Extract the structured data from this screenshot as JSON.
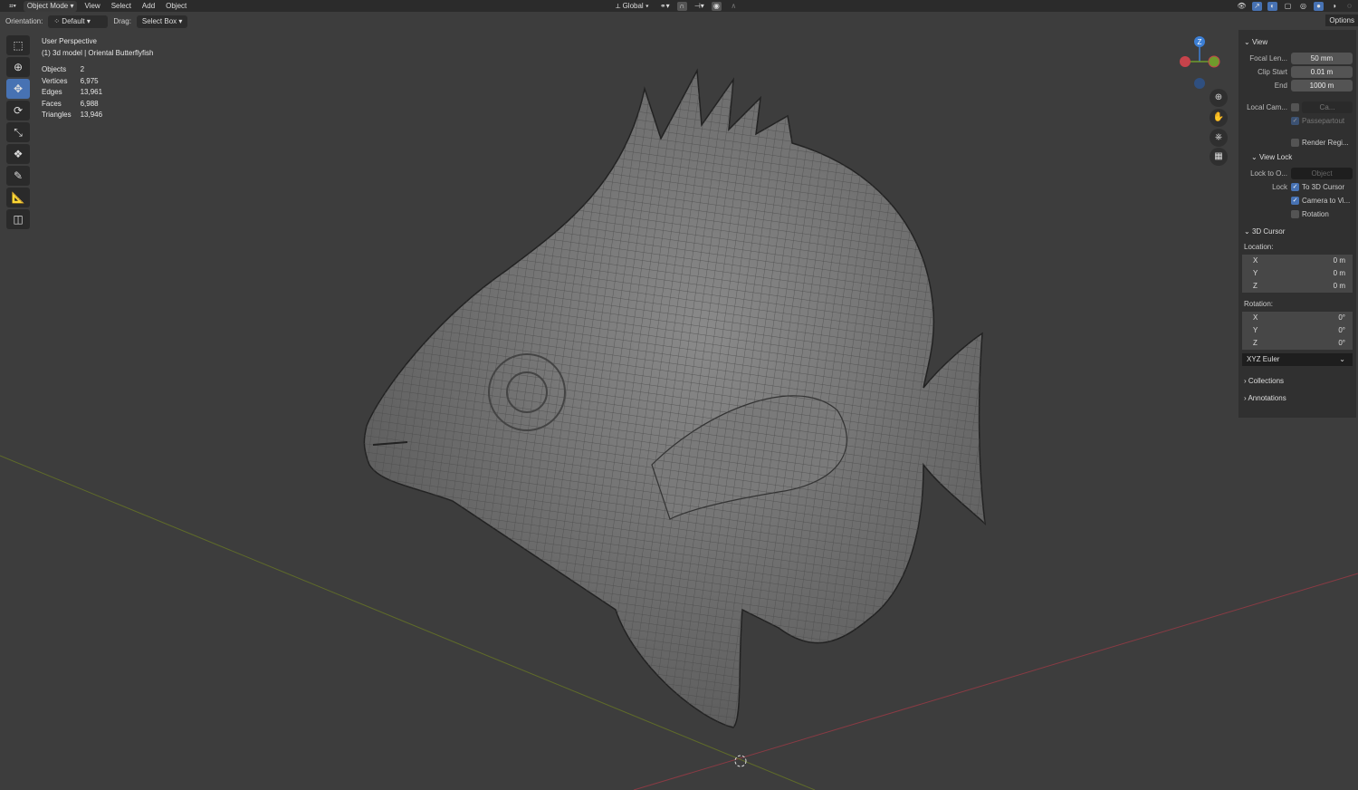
{
  "topbar": {
    "mode": "Object Mode",
    "menus": [
      "View",
      "Select",
      "Add",
      "Object"
    ],
    "transform_orientation": "Global"
  },
  "toolheader": {
    "orientation_label": "Orientation:",
    "orientation_value": "Default",
    "drag_label": "Drag:",
    "drag_value": "Select Box",
    "options": "Options"
  },
  "overlay": {
    "view": "User Perspective",
    "object": "(1) 3d model | Oriental Butterflyfish",
    "stats": [
      {
        "k": "Objects",
        "v": "2"
      },
      {
        "k": "Vertices",
        "v": "6,975"
      },
      {
        "k": "Edges",
        "v": "13,961"
      },
      {
        "k": "Faces",
        "v": "6,988"
      },
      {
        "k": "Triangles",
        "v": "13,946"
      }
    ]
  },
  "gizmo": {
    "z": "Z",
    "colors": {
      "x": "#c7434b",
      "y": "#6f9b2c",
      "z": "#3c7fd5"
    }
  },
  "panel": {
    "view": {
      "title": "View",
      "focal_label": "Focal Len...",
      "focal": "50 mm",
      "clip_start_label": "Clip Start",
      "clip_start": "0.01 m",
      "end_label": "End",
      "end": "1000 m",
      "local_cam_label": "Local Cam...",
      "local_cam_value": "Ca...",
      "passepartout": "Passepartout",
      "render_region": "Render Regi..."
    },
    "view_lock": {
      "title": "View Lock",
      "lock_to_label": "Lock to O...",
      "lock_to_placeholder": "Object",
      "lock_label": "Lock",
      "to_cursor": "To 3D Cursor",
      "camera_to_view": "Camera to Vi...",
      "rotation": "Rotation"
    },
    "cursor": {
      "title": "3D Cursor",
      "location_label": "Location:",
      "location": [
        {
          "axis": "X",
          "v": "0 m"
        },
        {
          "axis": "Y",
          "v": "0 m"
        },
        {
          "axis": "Z",
          "v": "0 m"
        }
      ],
      "rotation_label": "Rotation:",
      "rotation": [
        {
          "axis": "X",
          "v": "0°"
        },
        {
          "axis": "Y",
          "v": "0°"
        },
        {
          "axis": "Z",
          "v": "0°"
        }
      ],
      "mode": "XYZ Euler"
    },
    "collections": "Collections",
    "annotations": "Annotations"
  },
  "colors": {
    "accent": "#4772b3",
    "viewport": "#3d3d3d",
    "panel": "#303030"
  }
}
